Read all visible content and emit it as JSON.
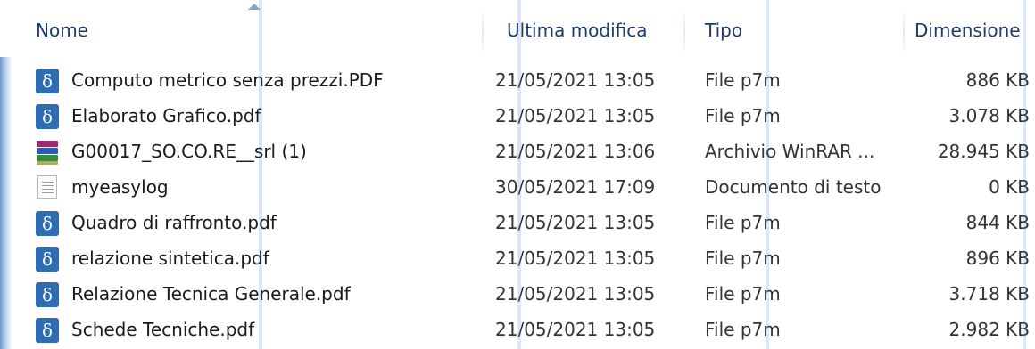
{
  "headers": {
    "name": "Nome",
    "modified": "Ultima modifica",
    "type": "Tipo",
    "size": "Dimensione"
  },
  "files": [
    {
      "icon": "p7m-signed-document-icon",
      "glyph": "δ",
      "name": "Computo metrico senza prezzi.PDF",
      "modified": "21/05/2021 13:05",
      "type": "File p7m",
      "size": "886 KB"
    },
    {
      "icon": "p7m-signed-document-icon",
      "glyph": "δ",
      "name": "Elaborato Grafico.pdf",
      "modified": "21/05/2021 13:05",
      "type": "File p7m",
      "size": "3.078 KB"
    },
    {
      "icon": "winrar-archive-icon",
      "glyph": "",
      "name": "G00017_SO.CO.RE__srl (1)",
      "modified": "21/05/2021 13:06",
      "type": "Archivio WinRAR ...",
      "size": "28.945 KB"
    },
    {
      "icon": "text-document-icon",
      "glyph": "",
      "name": "myeasylog",
      "modified": "30/05/2021 17:09",
      "type": "Documento di testo",
      "size": "0 KB"
    },
    {
      "icon": "p7m-signed-document-icon",
      "glyph": "δ",
      "name": "Quadro di raffronto.pdf",
      "modified": "21/05/2021 13:05",
      "type": "File p7m",
      "size": "844 KB"
    },
    {
      "icon": "p7m-signed-document-icon",
      "glyph": "δ",
      "name": "relazione sintetica.pdf",
      "modified": "21/05/2021 13:05",
      "type": "File p7m",
      "size": "896 KB"
    },
    {
      "icon": "p7m-signed-document-icon",
      "glyph": "δ",
      "name": "Relazione Tecnica Generale.pdf",
      "modified": "21/05/2021 13:05",
      "type": "File p7m",
      "size": "3.718 KB"
    },
    {
      "icon": "p7m-signed-document-icon",
      "glyph": "δ",
      "name": "Schede Tecniche.pdf",
      "modified": "21/05/2021 13:05",
      "type": "File p7m",
      "size": "2.982 KB"
    }
  ],
  "colors": {
    "header_text": "#1f3a67",
    "p7m_icon": "#2f6db3"
  }
}
